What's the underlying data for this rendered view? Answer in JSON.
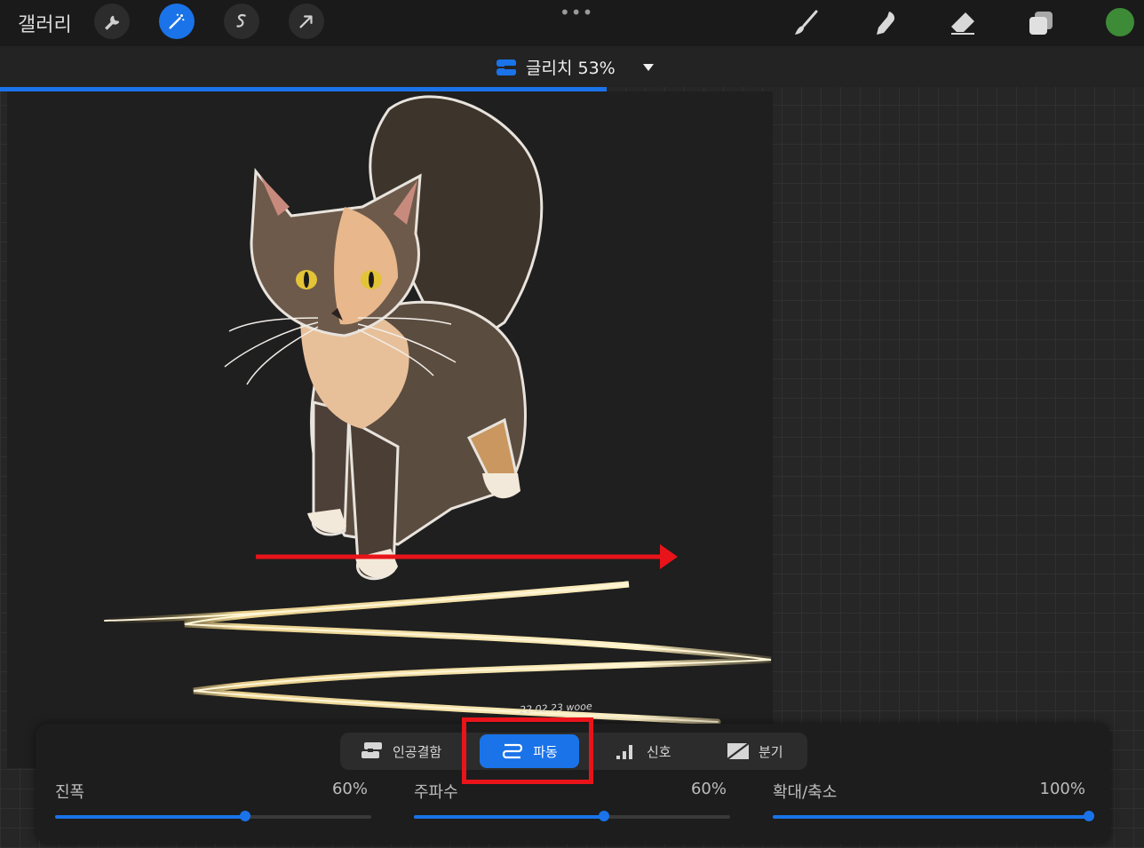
{
  "topbar": {
    "gallery_label": "갤러리",
    "left_tools": [
      "wrench-icon",
      "magic-wand-icon",
      "selection-icon",
      "transform-arrow-icon"
    ],
    "active_tool": "magic-wand-icon",
    "more": "•••",
    "right_tools": [
      "brush-icon",
      "smudge-icon",
      "eraser-icon",
      "layers-icon"
    ],
    "color": "#3d8b37"
  },
  "effect": {
    "name": "글리치 53%",
    "progress": 0.53
  },
  "canvas": {
    "signature": "22.02.23 wooe"
  },
  "modes": [
    {
      "label": "인공결함",
      "icon": "artifact-icon",
      "active": false
    },
    {
      "label": "파동",
      "icon": "wave-icon",
      "active": true
    },
    {
      "label": "신호",
      "icon": "signal-bars-icon",
      "active": false
    },
    {
      "label": "분기",
      "icon": "diverge-icon",
      "active": false
    }
  ],
  "sliders": [
    {
      "label": "진폭",
      "value": "60%",
      "fraction": 0.6
    },
    {
      "label": "주파수",
      "value": "60%",
      "fraction": 0.6
    },
    {
      "label": "확대/축소",
      "value": "100%",
      "fraction": 1.0
    }
  ],
  "colors": {
    "accent": "#1a73e8",
    "highlight": "#e8141a"
  }
}
